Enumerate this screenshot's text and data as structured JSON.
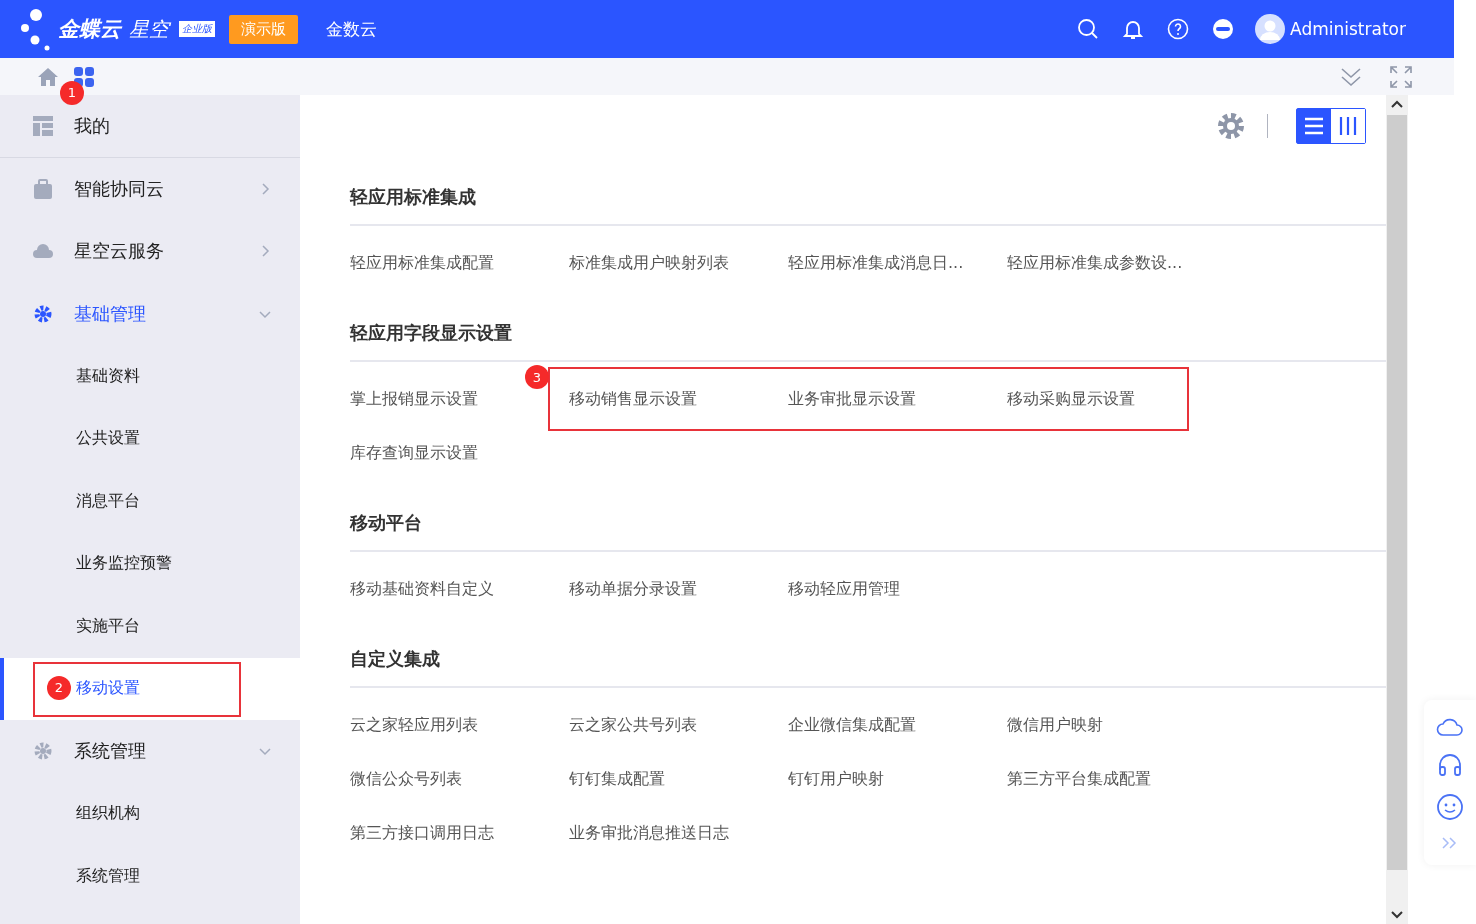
{
  "header": {
    "logo": "金蝶云",
    "logo_sub": "星空",
    "edition": "企业版",
    "demo_badge": "演示版",
    "nav_link": "金数云",
    "user": "Administrator"
  },
  "subbar": {
    "apps_callout": "1"
  },
  "sidebar": {
    "items": [
      {
        "label": "我的",
        "kind": "top",
        "selected": false
      },
      {
        "label": "智能协同云",
        "kind": "group",
        "expanded": false,
        "selected": false
      },
      {
        "label": "星空云服务",
        "kind": "group",
        "expanded": false,
        "selected": false
      },
      {
        "label": "基础管理",
        "kind": "group",
        "expanded": true,
        "selected": true,
        "children": [
          {
            "label": "基础资料",
            "selected": false,
            "highlighted": false
          },
          {
            "label": "公共设置",
            "selected": false,
            "highlighted": false
          },
          {
            "label": "消息平台",
            "selected": false,
            "highlighted": false
          },
          {
            "label": "业务监控预警",
            "selected": false,
            "highlighted": false
          },
          {
            "label": "实施平台",
            "selected": false,
            "highlighted": false
          },
          {
            "label": "移动设置",
            "selected": true,
            "callout": "2",
            "highlighted": true
          }
        ]
      },
      {
        "label": "系统管理",
        "kind": "group",
        "expanded": true,
        "selected": false,
        "children": [
          {
            "label": "组织机构",
            "selected": false,
            "highlighted": false
          },
          {
            "label": "系统管理",
            "selected": false,
            "highlighted": false
          }
        ]
      }
    ]
  },
  "view_toggle": [
    {
      "kind": "list",
      "selected": true
    },
    {
      "kind": "columns",
      "selected": false
    }
  ],
  "sections": [
    {
      "title": "轻应用标准集成",
      "items": [
        {
          "kind": "link",
          "label": "轻应用标准集成配置"
        },
        {
          "kind": "link",
          "label": "标准集成用户映射列表"
        },
        {
          "kind": "link",
          "label": "轻应用标准集成消息日..."
        },
        {
          "kind": "link",
          "label": "轻应用标准集成参数设..."
        }
      ]
    },
    {
      "title": "轻应用字段显示设置",
      "items": [
        {
          "kind": "link",
          "label": "掌上报销显示设置"
        },
        {
          "kind": "highlight_group",
          "callout": "3",
          "links": [
            "移动销售显示设置",
            "业务审批显示设置",
            "移动采购显示设置"
          ]
        },
        {
          "kind": "link",
          "label": "库存查询显示设置"
        }
      ]
    },
    {
      "title": "移动平台",
      "items": [
        {
          "kind": "link",
          "label": "移动基础资料自定义"
        },
        {
          "kind": "link",
          "label": "移动单据分录设置"
        },
        {
          "kind": "link",
          "label": "移动轻应用管理"
        }
      ]
    },
    {
      "title": "自定义集成",
      "items": [
        {
          "kind": "link",
          "label": "云之家轻应用列表"
        },
        {
          "kind": "link",
          "label": "云之家公共号列表"
        },
        {
          "kind": "link",
          "label": "企业微信集成配置"
        },
        {
          "kind": "link",
          "label": "微信用户映射"
        },
        {
          "kind": "link",
          "label": "微信公众号列表"
        },
        {
          "kind": "link",
          "label": "钉钉集成配置"
        },
        {
          "kind": "link",
          "label": "钉钉用户映射"
        },
        {
          "kind": "link",
          "label": "第三方平台集成配置"
        },
        {
          "kind": "link",
          "label": "第三方接口调用日志"
        },
        {
          "kind": "link",
          "label": "业务审批消息推送日志"
        }
      ]
    }
  ]
}
